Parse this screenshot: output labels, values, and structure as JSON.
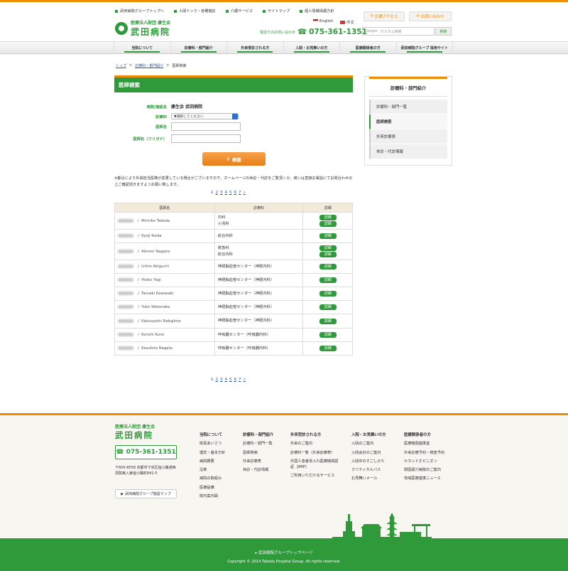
{
  "header": {
    "toplinks": [
      "武田病院グループトップへ",
      "人間ドック・各種健診",
      "介護サービス",
      "サイトマップ",
      "個人情報保護方針"
    ],
    "logo_sub": "医療法人財団 康生会",
    "logo_main": "武田病院",
    "lang_en": "English",
    "lang_cn": "中文",
    "access_label": "交通アクセス",
    "contact_label": "お問い合わせ",
    "phone_label": "電話でのお問い合わせ",
    "phone": "075-361-1351",
    "search_brand": "Google",
    "search_placeholder": "カスタム検索",
    "search_button": "検索"
  },
  "nav": [
    "当院について",
    "診療科・部門紹介",
    "外来受診される方",
    "入院・お見舞いの方",
    "医療関係者の方",
    "武田病院グループ 採用サイト"
  ],
  "breadcrumb": [
    "トップ",
    "診療科・部門紹介",
    "医師検索"
  ],
  "page_title": "医師検索",
  "form": {
    "hospital_label": "病院/施設名",
    "hospital_value": "康生会 武田病院",
    "dept_label": "診療科",
    "dept_value": "▼選択してください",
    "name_label": "医師名",
    "kana_label": "医師名（フリガナ）",
    "search_label": "検索"
  },
  "note": "※都合により外来担当医等が変更している場合がございますので、ホームページの休診・代診をご覧頂くか、或いは直接お電話にてお問合わせの上ご確認頂きますようお願い致します。",
  "pager": [
    "1",
    "2",
    "3",
    "4",
    "5",
    "6",
    "7",
    "»"
  ],
  "table": {
    "headers": [
      "医師名",
      "診療科",
      "詳細"
    ],
    "detail_label": "詳細",
    "rows": [
      {
        "name": "Michiko Takeda",
        "depts": [
          "内科",
          "小児科"
        ]
      },
      {
        "name": "Kyoji Ikeda",
        "depts": [
          "総合内科"
        ]
      },
      {
        "name": "Akinori Nagano",
        "depts": [
          "救急科",
          "総合内科"
        ]
      },
      {
        "name": "Ichiro Akiguchi",
        "depts": [
          "神経脳血管センター（神経内科）"
        ]
      },
      {
        "name": "Hideo Yagi",
        "depts": [
          "神経脳血管センター（神経内科）"
        ]
      },
      {
        "name": "Taruaki Kawasaki",
        "depts": [
          "神経脳血管センター（神経内科）"
        ]
      },
      {
        "name": "Yuko Watanabe",
        "depts": [
          "神経脳血管センター（神経内科）"
        ]
      },
      {
        "name": "Katsuyoshi Nakajima",
        "depts": [
          "神経脳血管センター（神経内科）"
        ]
      },
      {
        "name": "Kenshi Kuno",
        "depts": [
          "呼吸器センター（呼吸器内科）"
        ]
      },
      {
        "name": "Kazuhiro Nagata",
        "depts": [
          "呼吸器センター（呼吸器内科）"
        ]
      }
    ]
  },
  "sidebar": {
    "title": "診療科・部門紹介",
    "items": [
      "診療科・部門一覧",
      "医師検索",
      "外来診療表",
      "休診・代診情報"
    ]
  },
  "footer": {
    "logo_sub": "医療法人財団 康生会",
    "logo_main": "武田病院",
    "phone": "075-361-1351",
    "address": "〒600-8558 京都市下京区塩小路通西洞院東入東塩小路町841-5",
    "map_label": "武田病院グループ施設マップ",
    "cols": [
      {
        "head": "当院について",
        "items": [
          "院長あいさつ",
          "理念・基本方針",
          "病院概要",
          "沿革",
          "病院の取組み",
          "医療設備",
          "院内案内図"
        ]
      },
      {
        "head": "診療科・部門紹介",
        "items": [
          "診療科・部門一覧",
          "医師検索",
          "外来診療表",
          "休診・代診情報"
        ]
      },
      {
        "head": "外来受診される方",
        "items": [
          "外来のご案内",
          "診療科一覧（外来診療表）",
          "外国人患者受入れ医療機関認証（JMIP）",
          "ご利用いただけるサービス"
        ]
      },
      {
        "head": "入院・お見舞いの方",
        "items": [
          "入院のご案内",
          "入院会計のご案内",
          "入院中のすごしかた",
          "クリティカルパス",
          "お見舞いメール"
        ]
      },
      {
        "head": "医療関係者の方",
        "items": [
          "医療機関連携室",
          "外来診療予約・検査予約",
          "セカンドオピニオン",
          "関医紹介病院のご案内",
          "地域医療連携ニュース"
        ]
      }
    ],
    "group_link": "武田病院グループトップページ",
    "copyright": "Copyright © 2014 Takeda Hospital Group. All rights reserved."
  },
  "colors": {
    "brand_green": "#2e9a3a",
    "accent_orange": "#f08c00"
  }
}
